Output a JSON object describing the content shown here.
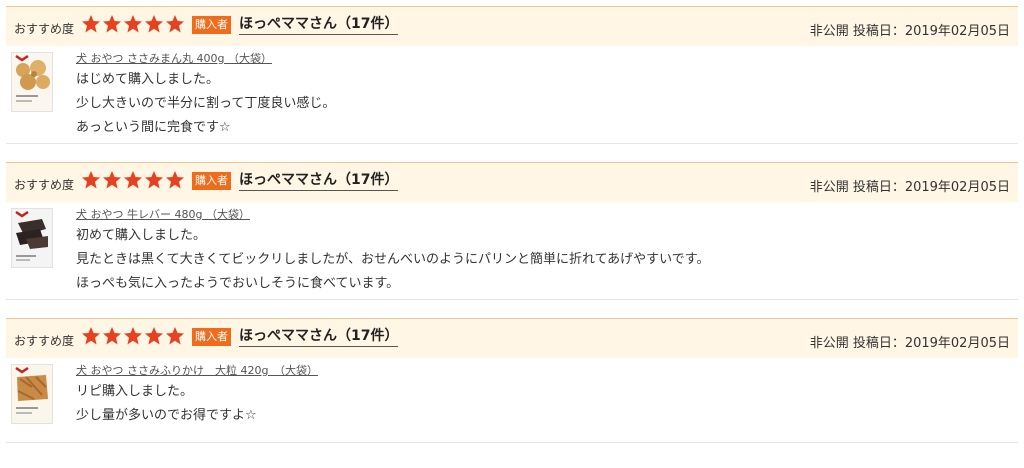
{
  "colors": {
    "header_bg": "#fff6e6",
    "header_border": "#f2c98a",
    "star": "#e8411f",
    "badge": "#f06c1d"
  },
  "reviews": [
    {
      "rec_label": "おすすめ度",
      "rating": 5,
      "badge": "購入者",
      "reviewer": "ほっぺママさん（17件）",
      "meta": "非公開 投稿日：2019年02月05日",
      "product_icon": "treats-bag-thumbnail",
      "product_link": "犬 おやつ ささみまん丸 400g （大袋）",
      "comment": [
        "はじめて購入しました。",
        "少し大きいので半分に割って丁度良い感じ。",
        "あっという間に完食です☆"
      ]
    },
    {
      "rec_label": "おすすめ度",
      "rating": 5,
      "badge": "購入者",
      "reviewer": "ほっぺママさん（17件）",
      "meta": "非公開 投稿日：2019年02月05日",
      "product_icon": "liver-bag-thumbnail",
      "product_link": "犬 おやつ 牛レバー 480g （大袋）",
      "comment": [
        "初めて購入しました。",
        "見たときは黒くて大きくてビックリしましたが、おせんべいのようにパリンと簡単に折れてあげやすいです。",
        "ほっぺも気に入ったようでおいしそうに食べています。"
      ]
    },
    {
      "rec_label": "おすすめ度",
      "rating": 5,
      "badge": "購入者",
      "reviewer": "ほっぺママさん（17件）",
      "meta": "非公開 投稿日：2019年02月05日",
      "product_icon": "furikake-bag-thumbnail",
      "product_link": "犬 おやつ ささみふりかけ　大粒 420g　（大袋）",
      "comment": [
        "リピ購入しました。",
        "少し量が多いのでお得ですよ☆"
      ]
    }
  ]
}
